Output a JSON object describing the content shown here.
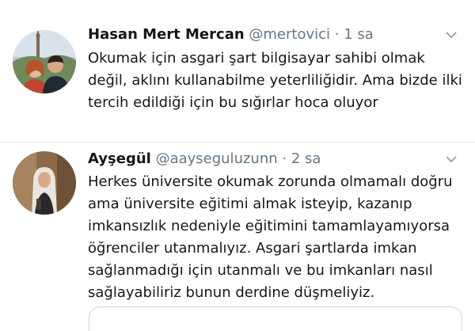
{
  "tweets": [
    {
      "name": "Hasan Mert Mercan",
      "handle": "@mertovici",
      "separator": "·",
      "time": "1 sa",
      "lines": [
        "Okumak için asgari şart bilgisayar sahibi olmak",
        "değil, aklını kullanabilme yeterliliğidir. Ama bizde ilki",
        "tercih edildiği için bu sığırlar hoca oluyor"
      ]
    },
    {
      "name": "Ayşegül",
      "handle": "@aayseguluzunn",
      "separator": "·",
      "time": "2 sa",
      "lines": [
        "Herkes üniversite okumak zorunda olmamalı doğru",
        "ama üniversite eğitimi almak isteyip, kazanıp",
        "imkansızlık nedeniyle eğitimini tamamlayamıyorsa",
        "öğrenciler utanmalıyız. Asgari şartlarda imkan",
        "sağlanmadığı için utanmalı ve bu imkanları nasıl",
        "sağlayabiliriz bunun derdine düşmeliyiz."
      ]
    }
  ],
  "icons": {
    "menu": "chevron-down-icon"
  },
  "colors": {
    "text": "#14171a",
    "secondary": "#657786",
    "divider": "#e6ecf0"
  }
}
